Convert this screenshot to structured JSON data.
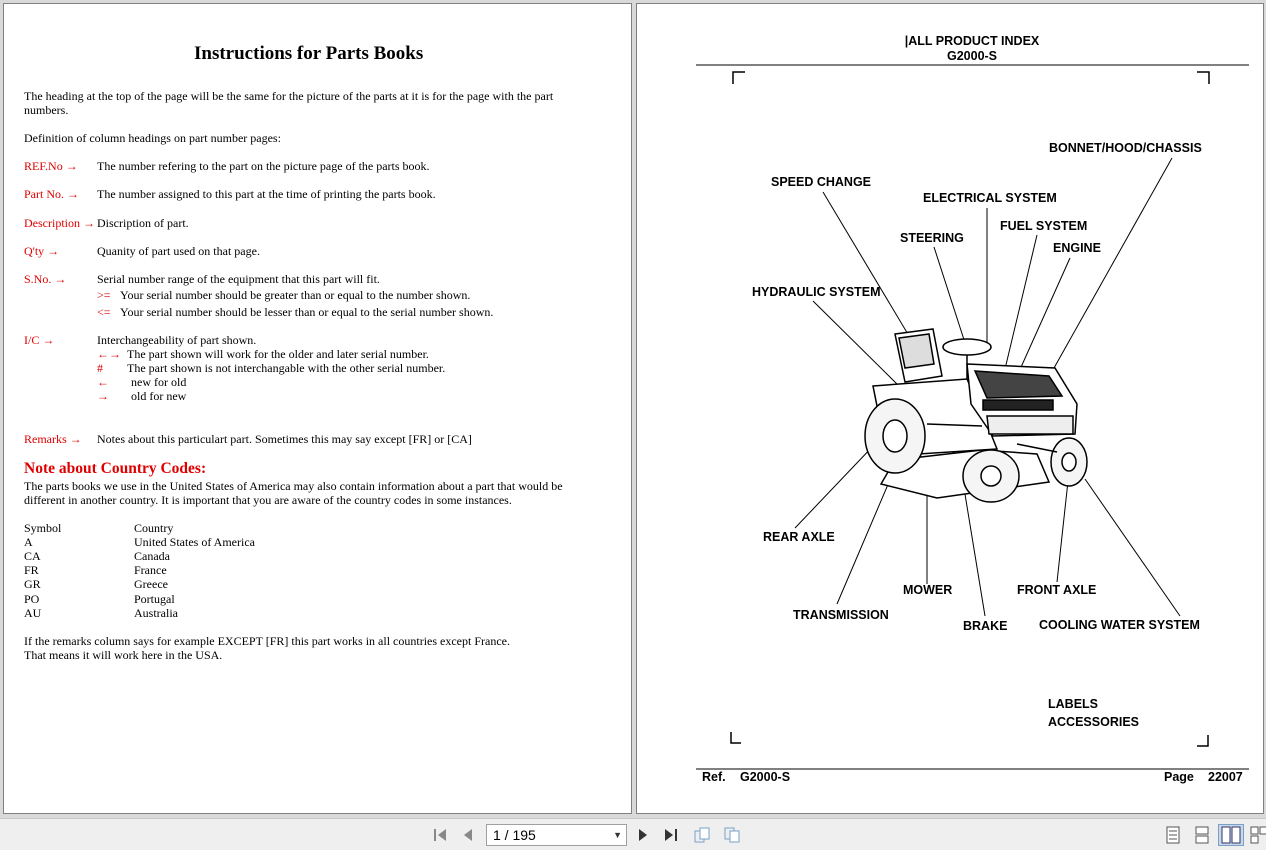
{
  "left_page": {
    "title": "Instructions for Parts Books",
    "intro_line1": "The heading at the top of the page will be the same for the picture of the parts at it is for the page with the part",
    "intro_line2": "numbers.",
    "definition_line": "Definition of column headings on part number pages:",
    "defs": [
      {
        "term": "REF.No →",
        "desc": "The number refering to the part on the picture page of the parts book."
      },
      {
        "term": "Part No. →",
        "desc": "The number assigned to this part at the time of printing the parts book."
      },
      {
        "term": "Description →",
        "desc": "Discription of part."
      },
      {
        "term": "Q'ty →",
        "desc": "Quanity of part used on that page."
      },
      {
        "term": "S.No. →",
        "desc": "Serial number range of the equipment that this part will fit."
      },
      {
        "term": "I/C →",
        "desc": "Interchangeability of part shown."
      },
      {
        "term": "Remarks →",
        "desc": "Notes about this particulart part. Sometimes this may say except [FR] or [CA]"
      }
    ],
    "sno_sub": [
      {
        "sym": ">=",
        "text": "Your serial number should be greater than or equal to the number shown."
      },
      {
        "sym": "<=",
        "text": "Your serial number should be lesser than or equal to the serial number shown."
      }
    ],
    "ic_sub": [
      {
        "sym": "←→",
        "text": "The part shown will work for the older and later serial number."
      },
      {
        "sym": "#",
        "text": "The part shown is not interchangable with the other serial number."
      },
      {
        "sym": "←",
        "text": "new for old"
      },
      {
        "sym": "→",
        "text": "old for new"
      }
    ],
    "note_heading": "Note about Country Codes:",
    "note_line1": "The parts books we use in the United States of America may also contain information about a part that would be",
    "note_line2": "different in another country. It is important that you are aware of the country codes in some instances.",
    "country_header": {
      "symbol": "Symbol",
      "country": "Country"
    },
    "countries": [
      {
        "symbol": "A",
        "country": "United States of America"
      },
      {
        "symbol": "CA",
        "country": "Canada"
      },
      {
        "symbol": "FR",
        "country": "France"
      },
      {
        "symbol": "GR",
        "country": "Greece"
      },
      {
        "symbol": "PO",
        "country": "Portugal"
      },
      {
        "symbol": "AU",
        "country": "Australia"
      }
    ],
    "footer_line1": "If the remarks column says for example EXCEPT [FR] this part works in all countries except France.",
    "footer_line2": "That means it will work here in the USA."
  },
  "right_page": {
    "header1": "|ALL PRODUCT INDEX",
    "header2": "G2000-S",
    "labels": {
      "bonnet": "BONNET/HOOD/CHASSIS",
      "speed": "SPEED CHANGE",
      "electrical": "ELECTRICAL SYSTEM",
      "fuel": "FUEL SYSTEM",
      "steering": "STEERING",
      "engine": "ENGINE",
      "hydraulic": "HYDRAULIC SYSTEM",
      "rear_axle": "REAR AXLE",
      "mower": "MOWER",
      "front_axle": "FRONT AXLE",
      "transmission": "TRANSMISSION",
      "brake": "BRAKE",
      "cooling": "COOLING WATER SYSTEM",
      "labels": "LABELS",
      "accessories": "ACCESSORIES"
    },
    "footer": {
      "ref_label": "Ref.",
      "ref_value": "G2000-S",
      "page_label": "Page",
      "page_value": "22007"
    }
  },
  "toolbar": {
    "page_indicator": "1 / 195",
    "icons": [
      "first-page-icon",
      "prev-page-icon",
      "next-page-icon",
      "last-page-icon",
      "rotate-icon",
      "fit-icon",
      "single-page-icon",
      "continuous-icon",
      "two-page-icon",
      "two-page-continuous-icon"
    ]
  }
}
